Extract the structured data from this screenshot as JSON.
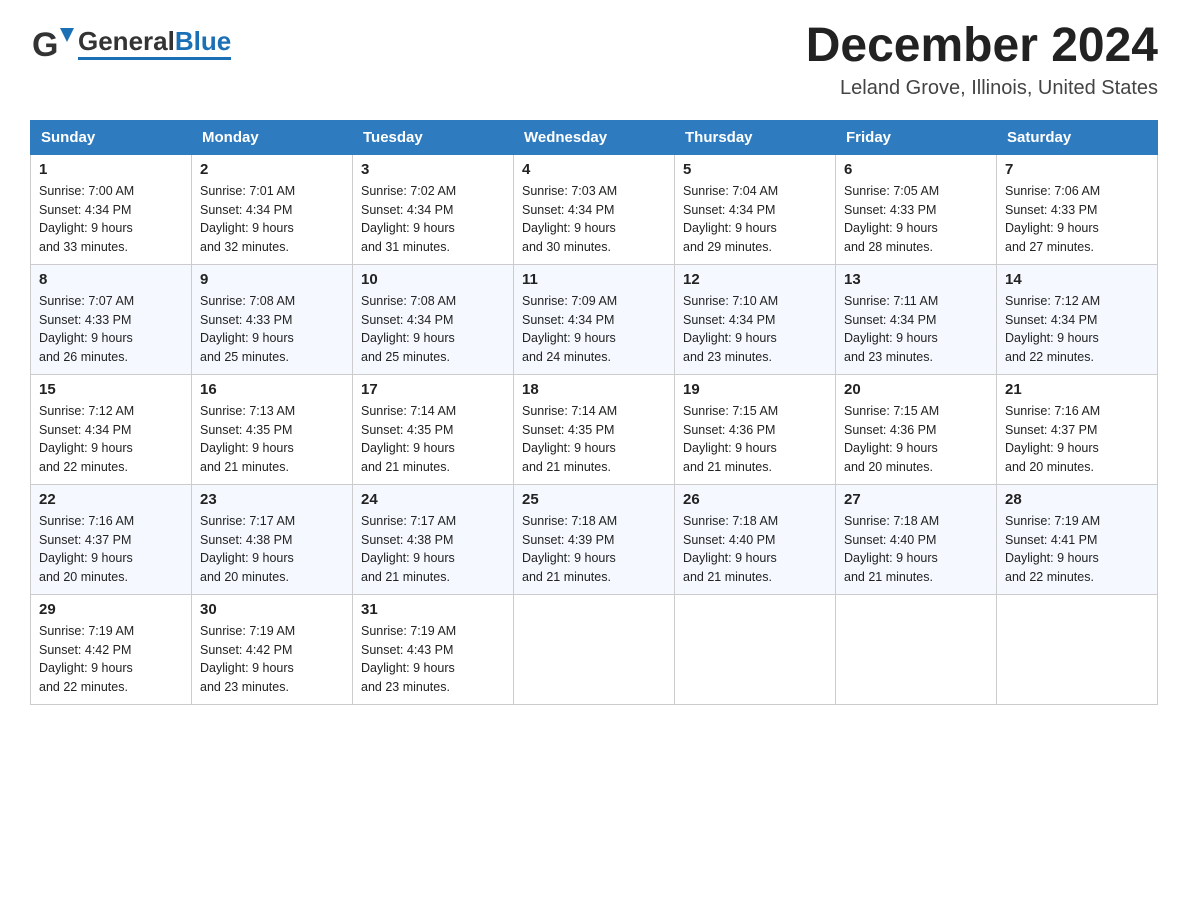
{
  "header": {
    "logo_general": "General",
    "logo_blue": "Blue",
    "month_title": "December 2024",
    "location": "Leland Grove, Illinois, United States"
  },
  "weekdays": [
    "Sunday",
    "Monday",
    "Tuesday",
    "Wednesday",
    "Thursday",
    "Friday",
    "Saturday"
  ],
  "weeks": [
    [
      {
        "day": "1",
        "sunrise": "7:00 AM",
        "sunset": "4:34 PM",
        "daylight": "9 hours and 33 minutes."
      },
      {
        "day": "2",
        "sunrise": "7:01 AM",
        "sunset": "4:34 PM",
        "daylight": "9 hours and 32 minutes."
      },
      {
        "day": "3",
        "sunrise": "7:02 AM",
        "sunset": "4:34 PM",
        "daylight": "9 hours and 31 minutes."
      },
      {
        "day": "4",
        "sunrise": "7:03 AM",
        "sunset": "4:34 PM",
        "daylight": "9 hours and 30 minutes."
      },
      {
        "day": "5",
        "sunrise": "7:04 AM",
        "sunset": "4:34 PM",
        "daylight": "9 hours and 29 minutes."
      },
      {
        "day": "6",
        "sunrise": "7:05 AM",
        "sunset": "4:33 PM",
        "daylight": "9 hours and 28 minutes."
      },
      {
        "day": "7",
        "sunrise": "7:06 AM",
        "sunset": "4:33 PM",
        "daylight": "9 hours and 27 minutes."
      }
    ],
    [
      {
        "day": "8",
        "sunrise": "7:07 AM",
        "sunset": "4:33 PM",
        "daylight": "9 hours and 26 minutes."
      },
      {
        "day": "9",
        "sunrise": "7:08 AM",
        "sunset": "4:33 PM",
        "daylight": "9 hours and 25 minutes."
      },
      {
        "day": "10",
        "sunrise": "7:08 AM",
        "sunset": "4:34 PM",
        "daylight": "9 hours and 25 minutes."
      },
      {
        "day": "11",
        "sunrise": "7:09 AM",
        "sunset": "4:34 PM",
        "daylight": "9 hours and 24 minutes."
      },
      {
        "day": "12",
        "sunrise": "7:10 AM",
        "sunset": "4:34 PM",
        "daylight": "9 hours and 23 minutes."
      },
      {
        "day": "13",
        "sunrise": "7:11 AM",
        "sunset": "4:34 PM",
        "daylight": "9 hours and 23 minutes."
      },
      {
        "day": "14",
        "sunrise": "7:12 AM",
        "sunset": "4:34 PM",
        "daylight": "9 hours and 22 minutes."
      }
    ],
    [
      {
        "day": "15",
        "sunrise": "7:12 AM",
        "sunset": "4:34 PM",
        "daylight": "9 hours and 22 minutes."
      },
      {
        "day": "16",
        "sunrise": "7:13 AM",
        "sunset": "4:35 PM",
        "daylight": "9 hours and 21 minutes."
      },
      {
        "day": "17",
        "sunrise": "7:14 AM",
        "sunset": "4:35 PM",
        "daylight": "9 hours and 21 minutes."
      },
      {
        "day": "18",
        "sunrise": "7:14 AM",
        "sunset": "4:35 PM",
        "daylight": "9 hours and 21 minutes."
      },
      {
        "day": "19",
        "sunrise": "7:15 AM",
        "sunset": "4:36 PM",
        "daylight": "9 hours and 21 minutes."
      },
      {
        "day": "20",
        "sunrise": "7:15 AM",
        "sunset": "4:36 PM",
        "daylight": "9 hours and 20 minutes."
      },
      {
        "day": "21",
        "sunrise": "7:16 AM",
        "sunset": "4:37 PM",
        "daylight": "9 hours and 20 minutes."
      }
    ],
    [
      {
        "day": "22",
        "sunrise": "7:16 AM",
        "sunset": "4:37 PM",
        "daylight": "9 hours and 20 minutes."
      },
      {
        "day": "23",
        "sunrise": "7:17 AM",
        "sunset": "4:38 PM",
        "daylight": "9 hours and 20 minutes."
      },
      {
        "day": "24",
        "sunrise": "7:17 AM",
        "sunset": "4:38 PM",
        "daylight": "9 hours and 21 minutes."
      },
      {
        "day": "25",
        "sunrise": "7:18 AM",
        "sunset": "4:39 PM",
        "daylight": "9 hours and 21 minutes."
      },
      {
        "day": "26",
        "sunrise": "7:18 AM",
        "sunset": "4:40 PM",
        "daylight": "9 hours and 21 minutes."
      },
      {
        "day": "27",
        "sunrise": "7:18 AM",
        "sunset": "4:40 PM",
        "daylight": "9 hours and 21 minutes."
      },
      {
        "day": "28",
        "sunrise": "7:19 AM",
        "sunset": "4:41 PM",
        "daylight": "9 hours and 22 minutes."
      }
    ],
    [
      {
        "day": "29",
        "sunrise": "7:19 AM",
        "sunset": "4:42 PM",
        "daylight": "9 hours and 22 minutes."
      },
      {
        "day": "30",
        "sunrise": "7:19 AM",
        "sunset": "4:42 PM",
        "daylight": "9 hours and 23 minutes."
      },
      {
        "day": "31",
        "sunrise": "7:19 AM",
        "sunset": "4:43 PM",
        "daylight": "9 hours and 23 minutes."
      },
      null,
      null,
      null,
      null
    ]
  ],
  "labels": {
    "sunrise": "Sunrise:",
    "sunset": "Sunset:",
    "daylight": "Daylight:"
  }
}
